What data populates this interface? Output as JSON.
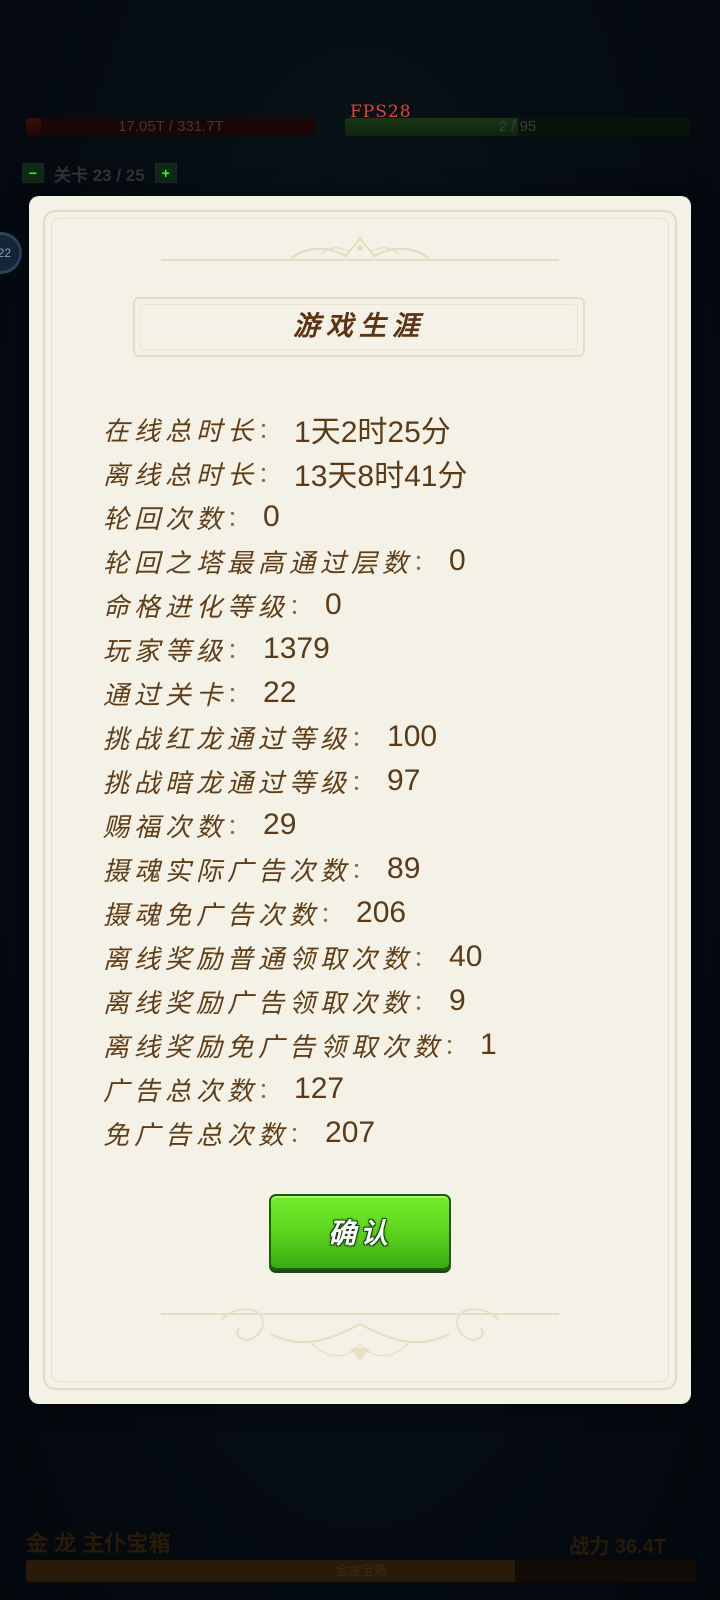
{
  "hud": {
    "fps": "FPS28",
    "hp_text": "17.05T / 331.7T",
    "hp_fraction": 0.05,
    "xp_text": "2 / 95",
    "xp_fraction": 0.5,
    "stage_text": "关卡 23 / 25",
    "stage_prev": "−",
    "stage_next": "+",
    "player_level": "22"
  },
  "bottom_hud": {
    "name": "金 龙 主仆宝箱",
    "power": "战力 36.4T",
    "bar_text": "金龙宝箱",
    "bar_fraction": 0.73
  },
  "modal": {
    "title": "游戏生涯",
    "colon": "：",
    "stats": [
      {
        "label": "在线总时长",
        "value": "1天2时25分"
      },
      {
        "label": "离线总时长",
        "value": "13天8时41分"
      },
      {
        "label": "轮回次数",
        "value": "0"
      },
      {
        "label": "轮回之塔最高通过层数",
        "value": "0"
      },
      {
        "label": "命格进化等级",
        "value": "0"
      },
      {
        "label": "玩家等级",
        "value": "1379"
      },
      {
        "label": "通过关卡",
        "value": "22"
      },
      {
        "label": "挑战红龙通过等级",
        "value": "100"
      },
      {
        "label": "挑战暗龙通过等级",
        "value": "97"
      },
      {
        "label": "赐福次数",
        "value": "29"
      },
      {
        "label": "摄魂实际广告次数",
        "value": "89"
      },
      {
        "label": "摄魂免广告次数",
        "value": "206"
      },
      {
        "label": "离线奖励普通领取次数",
        "value": "40"
      },
      {
        "label": "离线奖励广告领取次数",
        "value": "9"
      },
      {
        "label": "离线奖励免广告领取次数",
        "value": "1"
      },
      {
        "label": "广告总次数",
        "value": "127"
      },
      {
        "label": "免广告总次数",
        "value": "207"
      }
    ],
    "confirm_label": "确认"
  },
  "colors": {
    "panel_bg": "#f4f2e7",
    "text_brown": "#5f3d17",
    "button_green": "#5fd81f"
  }
}
